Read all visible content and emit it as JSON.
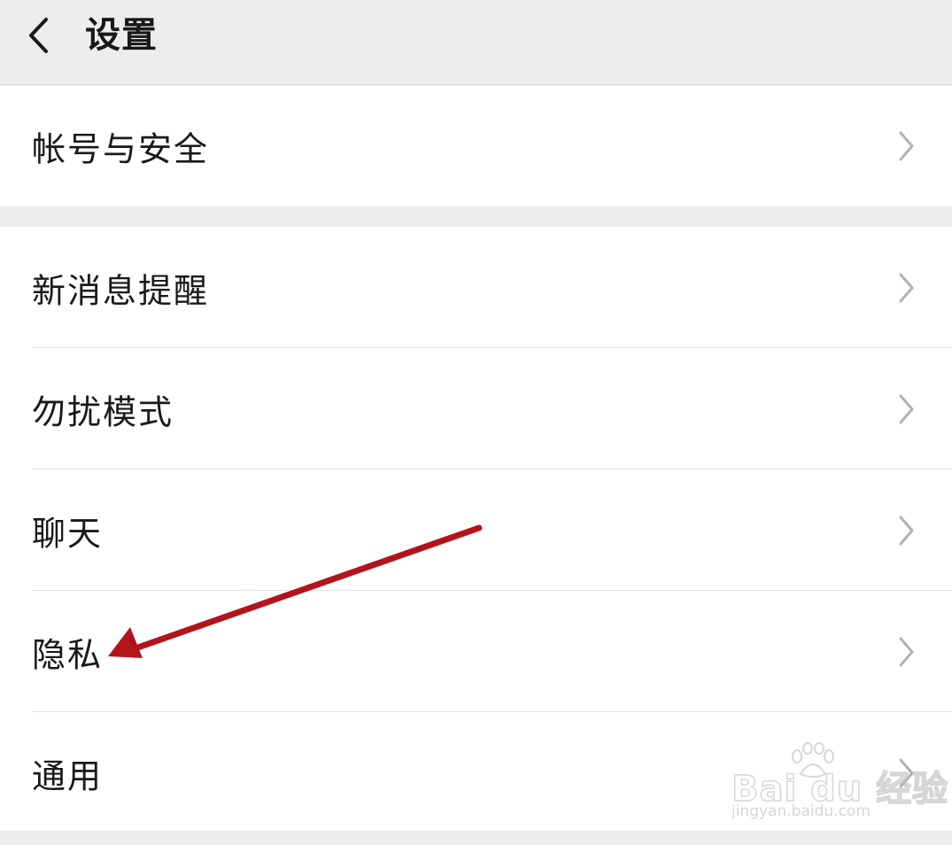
{
  "header": {
    "title": "设置",
    "back_icon": "chevron-left-icon"
  },
  "groups": [
    {
      "items": [
        {
          "label": "帐号与安全",
          "icon": "chevron-right-icon"
        }
      ]
    },
    {
      "items": [
        {
          "label": "新消息提醒",
          "icon": "chevron-right-icon"
        },
        {
          "label": "勿扰模式",
          "icon": "chevron-right-icon"
        },
        {
          "label": "聊天",
          "icon": "chevron-right-icon"
        },
        {
          "label": "隐私",
          "icon": "chevron-right-icon"
        },
        {
          "label": "通用",
          "icon": "chevron-right-icon"
        }
      ]
    }
  ],
  "annotation": {
    "type": "arrow",
    "color": "#b3141b",
    "points_to": "隐私"
  },
  "watermark": {
    "logo_text": "Bai du 经验",
    "url": "jingyan.baidu.com"
  },
  "colors": {
    "background": "#ededed",
    "card": "#ffffff",
    "text": "#191919",
    "chevron": "#b2b2b2",
    "arrow": "#b3141b"
  }
}
